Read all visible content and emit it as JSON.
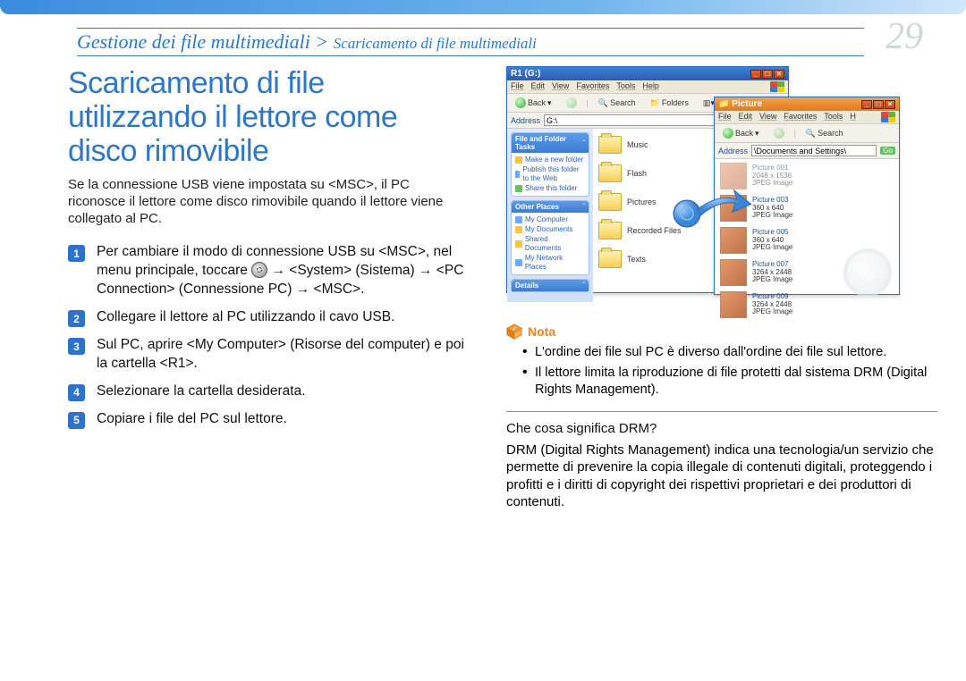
{
  "page_number": "29",
  "breadcrumb": {
    "section": "Gestione dei file multimediali",
    "separator": " > ",
    "subsection": "Scaricamento di file multimediali"
  },
  "title": "Scaricamento di file utilizzando il lettore come disco rimovibile",
  "intro": "Se la connessione USB viene impostata su <MSC>, il PC riconosce il lettore come disco rimovibile quando il lettore viene collegato al PC.",
  "steps": [
    "Per cambiare il modo di connessione USB su <MSC>, nel menu principale, toccare  [GEAR]  → <System> (Sistema)  → <PC Connection> (Connessione PC)  → <MSC>.",
    "Collegare il lettore al PC utilizzando il cavo USB.",
    "Sul PC, aprire <My Computer> (Risorse del computer) e poi la cartella <R1>.",
    "Selezionare la cartella desiderata.",
    "Copiare i file del PC sul lettore."
  ],
  "explorer1": {
    "title": "R1 (G:)",
    "menu": [
      "File",
      "Edit",
      "View",
      "Favorites",
      "Tools",
      "Help"
    ],
    "toolbar": {
      "back": "Back",
      "search": "Search",
      "folders": "Folders"
    },
    "address_label": "Address",
    "address_value": "G:\\",
    "side_panels": {
      "tasks": {
        "title": "File and Folder Tasks",
        "items": [
          "Make a new folder",
          "Publish this folder to the Web",
          "Share this folder"
        ]
      },
      "other": {
        "title": "Other Places",
        "items": [
          "My Computer",
          "My Documents",
          "Shared Documents",
          "My Network Places"
        ]
      },
      "details": {
        "title": "Details"
      }
    },
    "folders": [
      "Music",
      "Flash",
      "Pictures",
      "Recorded Files",
      "Texts"
    ]
  },
  "explorer2": {
    "title": "Picture",
    "menu": [
      "File",
      "Edit",
      "View",
      "Favorites",
      "Tools",
      "H"
    ],
    "toolbar": {
      "back": "Back",
      "search": "Search"
    },
    "address_label": "Address",
    "address_value": "\\Documents and Settings\\",
    "go_label": "Go",
    "items": [
      {
        "name": "Picture 001",
        "dims": "2048 x 1536",
        "type": "JPEG Image",
        "faded": true
      },
      {
        "name": "Picture 003",
        "dims": "360 x 640",
        "type": "JPEG Image"
      },
      {
        "name": "Picture 005",
        "dims": "360 x 640",
        "type": "JPEG Image"
      },
      {
        "name": "Picture 007",
        "dims": "3264 x 2448",
        "type": "JPEG Image"
      },
      {
        "name": "Picture 009",
        "dims": "3264 x 2448",
        "type": "JPEG Image"
      }
    ]
  },
  "nota": {
    "label": "Nota",
    "items": [
      "L'ordine dei file sul PC è diverso dall'ordine dei file sul lettore.",
      "Il lettore limita la riproduzione di file protetti dal sistema DRM (Digital Rights Management)."
    ]
  },
  "drm": {
    "question": "Che cosa significa DRM?",
    "answer": "DRM (Digital Rights Management) indica una tecnologia/un servizio che permette di prevenire la copia illegale di contenuti digitali, proteggendo i profitti e i diritti di copyright dei rispettivi proprietari e dei produttori di contenuti."
  }
}
